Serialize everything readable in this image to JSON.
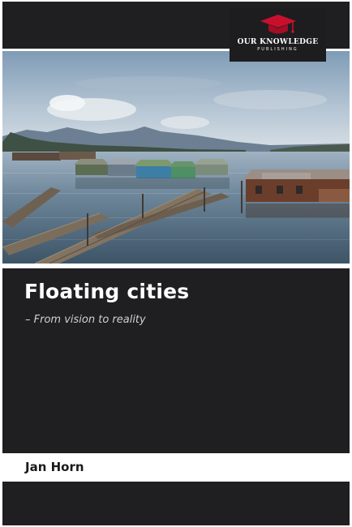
{
  "publisher": {
    "name": "OUR KNOWLEDGE",
    "subname": "PUBLISHING",
    "logo_icon": "graduation-cap-icon",
    "logo_color": "#c8102e"
  },
  "book": {
    "title": "Floating cities",
    "subtitle": "– From vision to reality",
    "author": "Jan Horn"
  },
  "cover_image": {
    "subject": "floating village",
    "icon": "photo-illustration"
  },
  "colors": {
    "band": "#1f1f21",
    "background": "#ffffff",
    "title_text": "#ffffff",
    "author_text": "#1a1a1a"
  }
}
